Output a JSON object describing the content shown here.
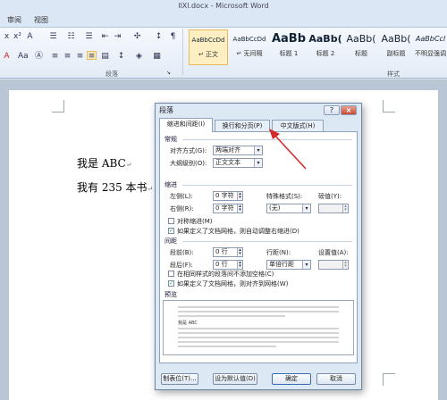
{
  "window": {
    "title": "llXl.docx - Microsoft Word"
  },
  "menu_tabs": [
    "审阅",
    "视图"
  ],
  "ribbon": {
    "group_paragraph": "段落",
    "group_styles": "样式",
    "styles": [
      {
        "preview": "AaBbCcDd",
        "name": "↵ 正文"
      },
      {
        "preview": "AaBbCcDd",
        "name": "↵ 无间隔"
      },
      {
        "preview": "AaBb",
        "name": "标题 1"
      },
      {
        "preview": "AaBb(",
        "name": "标题 2"
      },
      {
        "preview": "AaBb(",
        "name": "标题"
      },
      {
        "preview": "AaBb(",
        "name": "副标题"
      },
      {
        "preview": "AaBbCcl",
        "name": "不明显强调"
      }
    ]
  },
  "document": {
    "lines": [
      "我是 ABC",
      "我有 235 本书"
    ],
    "para_mark": "↵"
  },
  "dialog": {
    "title": "段落",
    "help": "?",
    "close": "×",
    "tabs": [
      "缩进和间距(I)",
      "换行和分页(P)",
      "中文版式(H)"
    ],
    "general": {
      "heading": "常规",
      "alignment_label": "对齐方式(G):",
      "alignment_value": "两端对齐",
      "outline_label": "大纲级别(O):",
      "outline_value": "正文文本"
    },
    "indent": {
      "heading": "缩进",
      "left_label": "左侧(L):",
      "left_value": "0 字符",
      "right_label": "右侧(R):",
      "right_value": "0 字符",
      "special_label": "特殊格式(S):",
      "special_value": "(无)",
      "by_label": "磅值(Y):",
      "mirror_label": "对称缩进(M)",
      "auto_adjust_label": "如果定义了文档网格，则自动调整右缩进(D)"
    },
    "spacing": {
      "heading": "间距",
      "before_label": "段前(B):",
      "before_value": "0 行",
      "after_label": "段后(F):",
      "after_value": "0 行",
      "line_label": "行距(N):",
      "line_value": "单倍行距",
      "at_label": "设置值(A):",
      "no_space_label": "在相同样式的段落间不添加空格(C)",
      "snap_grid_label": "如果定义了文档网格，则对齐到网格(W)"
    },
    "preview": {
      "heading": "预览",
      "sample": "我是 ABC"
    },
    "buttons": {
      "tabs": "制表位(T)...",
      "default": "设为默认值(D)",
      "ok": "确定",
      "cancel": "取消"
    }
  },
  "colors": {
    "arrow": "#d42a2a",
    "accent": "#3b6db3"
  }
}
